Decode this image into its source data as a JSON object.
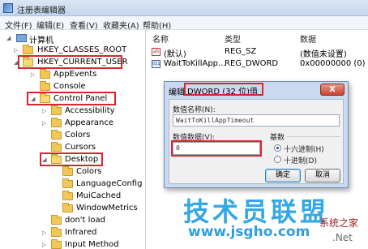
{
  "window": {
    "title": "注册表编辑器"
  },
  "menu": [
    "文件(F)",
    "编辑(E)",
    "查看(V)",
    "收藏夹(A)",
    "帮助(H)"
  ],
  "tree": {
    "computer": "计算机",
    "hkcr": "HKEY_CLASSES_ROOT",
    "hkcu": "HKEY_CURRENT_USER",
    "appevents": "AppEvents",
    "console": "Console",
    "control_panel": "Control Panel",
    "accessibility": "Accessibility",
    "appearance": "Appearance",
    "colors": "Colors",
    "cursors": "Cursors",
    "desktop": "Desktop",
    "desktop_colors": "Colors",
    "language_config": "LanguageConfig",
    "mui_cached": "MuiCached",
    "window_metrics": "WindowMetrics",
    "dont_load": "don't load",
    "infrared": "Infrared",
    "input_method": "Input Method"
  },
  "list": {
    "headers": {
      "name": "名称",
      "type": "类型",
      "data": "数据"
    },
    "rows": [
      {
        "name": "(默认)",
        "type": "REG_SZ",
        "data": "(数值未设置)",
        "icon": "ab-icon"
      },
      {
        "name": "WaitToKillApp...",
        "type": "REG_DWORD",
        "data": "0x00000000 (0)",
        "icon": "binary-icon"
      }
    ]
  },
  "dialog": {
    "title_prefix": "编辑",
    "title": "DWORD (32 位)值",
    "close": "X",
    "value_name_label": "数值名称(N):",
    "value_name": "WaitToKillAppTimeout",
    "value_data_label": "数值数据(V):",
    "value_data": "0",
    "base_label": "基数",
    "hex_label": "十六进制(H)",
    "dec_label": "十进制(D)",
    "ok": "确定",
    "cancel": "取消"
  },
  "watermark": {
    "brand": "技术员联盟",
    "url": "www.jsgho.com",
    "small": "系统之家",
    "net": ".Net"
  },
  "colors": {
    "highlight": "#d9262c",
    "watermark": "#35a7e6"
  }
}
